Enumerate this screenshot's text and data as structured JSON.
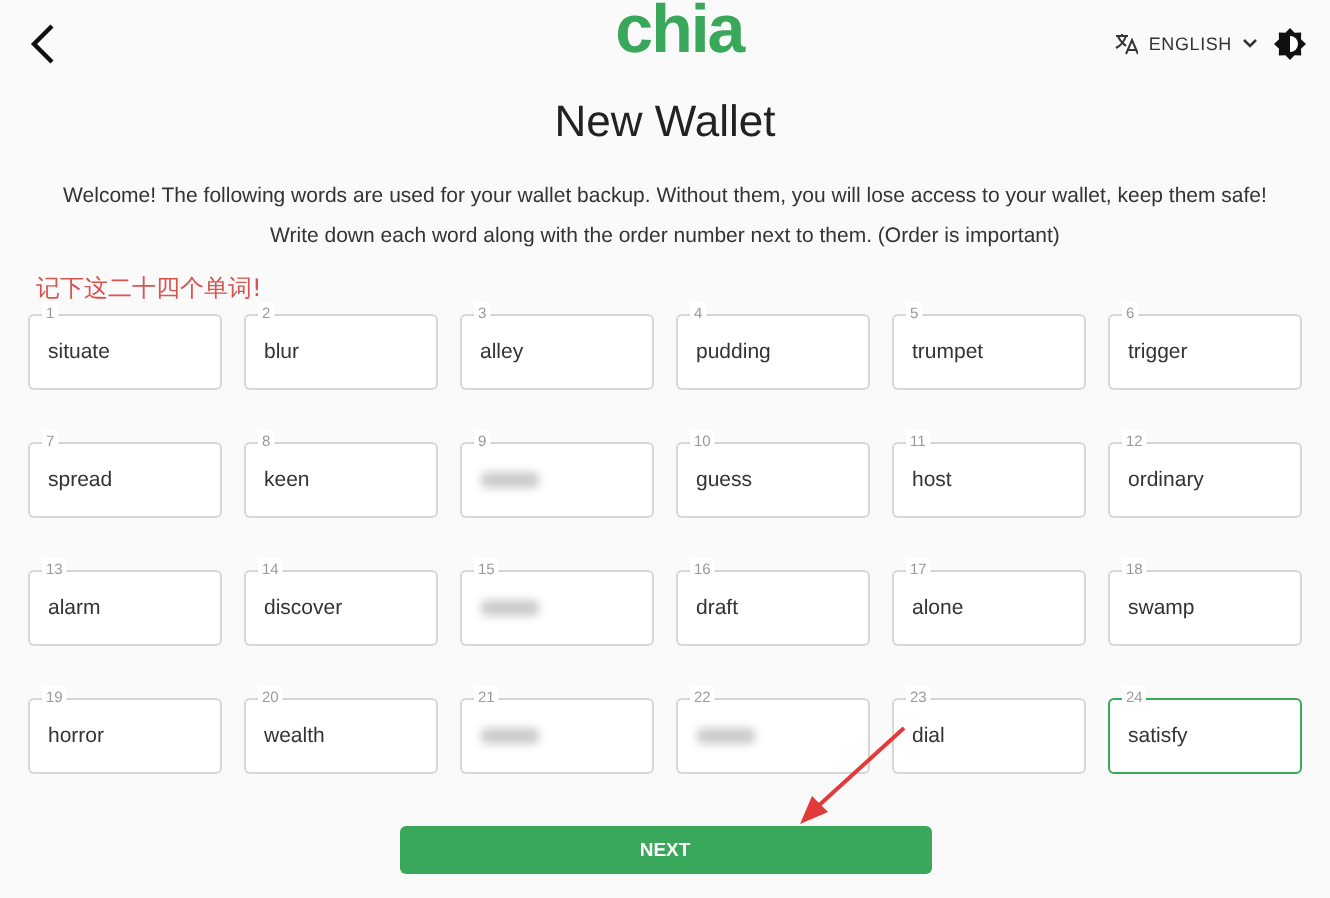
{
  "header": {
    "logo": "chia",
    "language": "ENGLISH"
  },
  "title": "New Wallet",
  "description": [
    "Welcome! The following words are used for your wallet backup. Without them, you will lose access to your wallet, keep them safe!",
    "Write down each word along with the order number next to them. (Order is important)"
  ],
  "annotation": "记下这二十四个单词!",
  "words": [
    {
      "number": "1",
      "word": "situate",
      "blurred": false,
      "focused": false
    },
    {
      "number": "2",
      "word": "blur",
      "blurred": false,
      "focused": false
    },
    {
      "number": "3",
      "word": "alley",
      "blurred": false,
      "focused": false
    },
    {
      "number": "4",
      "word": "pudding",
      "blurred": false,
      "focused": false
    },
    {
      "number": "5",
      "word": "trumpet",
      "blurred": false,
      "focused": false
    },
    {
      "number": "6",
      "word": "trigger",
      "blurred": false,
      "focused": false
    },
    {
      "number": "7",
      "word": "spread",
      "blurred": false,
      "focused": false
    },
    {
      "number": "8",
      "word": "keen",
      "blurred": false,
      "focused": false
    },
    {
      "number": "9",
      "blurred": true,
      "focused": false
    },
    {
      "number": "10",
      "word": "guess",
      "blurred": false,
      "focused": false
    },
    {
      "number": "11",
      "word": "host",
      "blurred": false,
      "focused": false
    },
    {
      "number": "12",
      "word": "ordinary",
      "blurred": false,
      "focused": false
    },
    {
      "number": "13",
      "word": "alarm",
      "blurred": false,
      "focused": false
    },
    {
      "number": "14",
      "word": "discover",
      "blurred": false,
      "focused": false
    },
    {
      "number": "15",
      "blurred": true,
      "focused": false
    },
    {
      "number": "16",
      "word": "draft",
      "blurred": false,
      "focused": false
    },
    {
      "number": "17",
      "word": "alone",
      "blurred": false,
      "focused": false
    },
    {
      "number": "18",
      "word": "swamp",
      "blurred": false,
      "focused": false
    },
    {
      "number": "19",
      "word": "horror",
      "blurred": false,
      "focused": false
    },
    {
      "number": "20",
      "word": "wealth",
      "blurred": false,
      "focused": false
    },
    {
      "number": "21",
      "blurred": true,
      "focused": false
    },
    {
      "number": "22",
      "blurred": true,
      "focused": false
    },
    {
      "number": "23",
      "word": "dial",
      "blurred": false,
      "focused": false
    },
    {
      "number": "24",
      "word": "satisfy",
      "blurred": false,
      "focused": true
    }
  ],
  "button": "NEXT"
}
